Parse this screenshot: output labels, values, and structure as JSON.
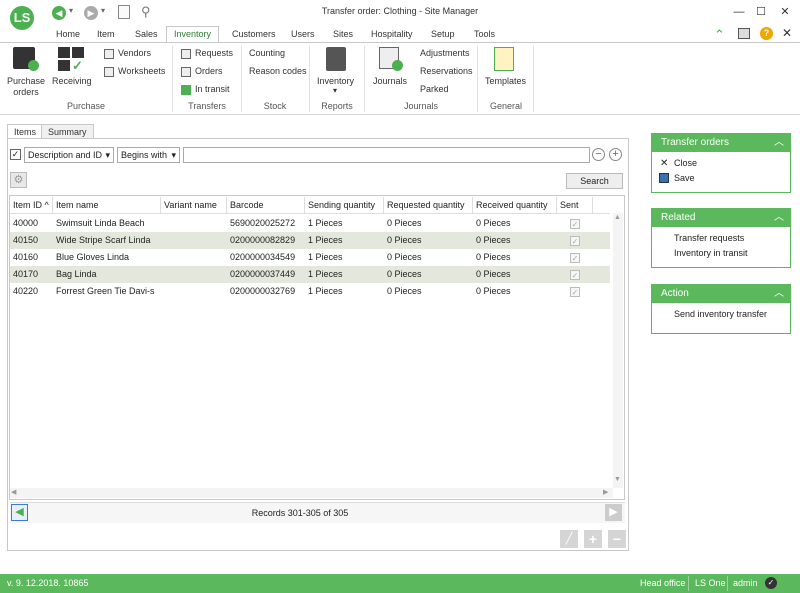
{
  "window": {
    "title": "Transfer order: Clothing - Site Manager",
    "logo_text": "LS"
  },
  "ribbon_tabs": [
    "Home",
    "Item",
    "Sales",
    "Inventory",
    "Customers",
    "Users",
    "Sites",
    "Hospitality",
    "Setup",
    "Tools"
  ],
  "active_tab": "Inventory",
  "ribbon": {
    "purchase_orders": "Purchase\norders",
    "receiving": "Receiving",
    "vendors": "Vendors",
    "worksheets": "Worksheets",
    "group_purchase": "Purchase",
    "requests": "Requests",
    "orders": "Orders",
    "in_transit": "In transit",
    "group_transfers": "Transfers",
    "counting": "Counting",
    "reason_codes": "Reason codes",
    "group_stock": "Stock",
    "inventory": "Inventory",
    "inventory_arrow": "▾",
    "group_reports": "Reports",
    "journals": "Journals",
    "adjustments": "Adjustments",
    "reservations": "Reservations",
    "parked": "Parked",
    "group_journals": "Journals",
    "templates": "Templates",
    "group_general": "General"
  },
  "page_tabs": [
    "Items",
    "Summary"
  ],
  "filter": {
    "field": "Description and ID",
    "operator": "Begins with",
    "value": "",
    "search_label": "Search"
  },
  "columns": [
    "Item ID",
    "Item name",
    "Variant name",
    "Barcode",
    "Sending quantity",
    "Requested quantity",
    "Received quantity",
    "Sent"
  ],
  "rows": [
    {
      "id": "40000",
      "name": "Swimsuit Linda Beach",
      "variant": "",
      "barcode": "5690020025272",
      "sending": "1 Pieces",
      "requested": "0 Pieces",
      "received": "0 Pieces"
    },
    {
      "id": "40150",
      "name": "Wide Stripe Scarf Linda",
      "variant": "",
      "barcode": "0200000082829",
      "sending": "1 Pieces",
      "requested": "0 Pieces",
      "received": "0 Pieces"
    },
    {
      "id": "40160",
      "name": "Blue Gloves Linda",
      "variant": "",
      "barcode": "0200000034549",
      "sending": "1 Pieces",
      "requested": "0 Pieces",
      "received": "0 Pieces"
    },
    {
      "id": "40170",
      "name": "Bag Linda",
      "variant": "",
      "barcode": "0200000037449",
      "sending": "1 Pieces",
      "requested": "0 Pieces",
      "received": "0 Pieces"
    },
    {
      "id": "40220",
      "name": "Forrest Green Tie Davi-s",
      "variant": "",
      "barcode": "0200000032769",
      "sending": "1 Pieces",
      "requested": "0 Pieces",
      "received": "0 Pieces"
    }
  ],
  "records_text": "Records 301-305 of 305",
  "panels": {
    "transfer_orders": {
      "title": "Transfer orders",
      "items": [
        "Close",
        "Save"
      ]
    },
    "related": {
      "title": "Related",
      "items": [
        "Transfer requests",
        "Inventory in transit"
      ]
    },
    "action": {
      "title": "Action",
      "items": [
        "Send inventory transfer"
      ]
    }
  },
  "status": {
    "version": "v. 9. 12.2018. 10865",
    "location": "Head office",
    "product": "LS One",
    "user": "admin"
  },
  "colors": {
    "accent": "#5cb85c",
    "row_alt": "#e4e8dc",
    "active_tab": "#2e7d32"
  }
}
